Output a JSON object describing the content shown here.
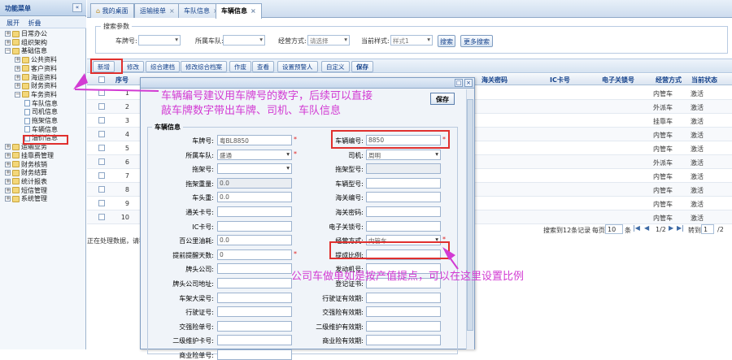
{
  "sidebar": {
    "title": "功能菜单",
    "collapse_glyph": "«",
    "expand_all": "展开",
    "collapse_all": "折叠",
    "items": [
      {
        "label": "日常办公",
        "level": 1,
        "type": "folder",
        "toggle": "+"
      },
      {
        "label": "组织架构",
        "level": 1,
        "type": "folder",
        "toggle": "+"
      },
      {
        "label": "基础信息",
        "level": 1,
        "type": "folder",
        "toggle": "−"
      },
      {
        "label": "公共资料",
        "level": 2,
        "type": "folder",
        "toggle": "+"
      },
      {
        "label": "客户资料",
        "level": 2,
        "type": "folder",
        "toggle": "+"
      },
      {
        "label": "海运资料",
        "level": 2,
        "type": "folder",
        "toggle": "+"
      },
      {
        "label": "财务资料",
        "level": 2,
        "type": "folder",
        "toggle": "+"
      },
      {
        "label": "车务资料",
        "level": 2,
        "type": "folder",
        "toggle": "−"
      },
      {
        "label": "车队信息",
        "level": 3,
        "type": "page",
        "toggle": ""
      },
      {
        "label": "司机信息",
        "level": 3,
        "type": "page",
        "toggle": ""
      },
      {
        "label": "拖架信息",
        "level": 3,
        "type": "page",
        "toggle": ""
      },
      {
        "label": "车辆信息",
        "level": 3,
        "type": "page",
        "toggle": ""
      },
      {
        "label": "油价信息",
        "level": 3,
        "type": "page",
        "toggle": ""
      },
      {
        "label": "运输业务",
        "level": 1,
        "type": "folder",
        "toggle": "+"
      },
      {
        "label": "挂靠费管理",
        "level": 1,
        "type": "folder",
        "toggle": "+"
      },
      {
        "label": "财务核销",
        "level": 1,
        "type": "folder",
        "toggle": "+"
      },
      {
        "label": "财务结算",
        "level": 1,
        "type": "folder",
        "toggle": "+"
      },
      {
        "label": "统计报表",
        "level": 1,
        "type": "folder",
        "toggle": "+"
      },
      {
        "label": "短信管理",
        "level": 1,
        "type": "folder",
        "toggle": "+"
      },
      {
        "label": "系统管理",
        "level": 1,
        "type": "folder",
        "toggle": "+"
      }
    ]
  },
  "tabs": [
    {
      "label": "我的桌面",
      "closable": false
    },
    {
      "label": "运输接单",
      "closable": true
    },
    {
      "label": "车队信息",
      "closable": true
    },
    {
      "label": "车辆信息",
      "closable": true
    }
  ],
  "search": {
    "legend": "搜索参数",
    "vehicle_no_label": "车牌号:",
    "fleet_label": "所属车队:",
    "mode_label": "经营方式:",
    "mode_value": "请选择",
    "style_label": "当前样式:",
    "style_value": "样式1",
    "search_btn": "搜索",
    "more_btn": "更多搜索"
  },
  "toolbar": [
    "新增",
    "修改",
    "综合建档",
    "修改综合档案",
    "作废",
    "查看",
    "设置预警人",
    "自定义",
    "保存"
  ],
  "grid": {
    "headers": {
      "no": "序号",
      "ecard": "海关密码",
      "ic": "IC卡号",
      "key": "电子关锁号",
      "mode": "经营方式",
      "status": "当前状态"
    },
    "rows": [
      {
        "no": "1",
        "mode": "内管车",
        "status": "激活"
      },
      {
        "no": "2",
        "mode": "外派车",
        "status": "激活"
      },
      {
        "no": "3",
        "mode": "挂靠车",
        "status": "激活"
      },
      {
        "no": "4",
        "mode": "内管车",
        "status": "激活"
      },
      {
        "no": "5",
        "mode": "内管车",
        "status": "激活"
      },
      {
        "no": "6",
        "mode": "外派车",
        "status": "激活"
      },
      {
        "no": "7",
        "mode": "内管车",
        "status": "激活"
      },
      {
        "no": "8",
        "mode": "内管车",
        "status": "激活"
      },
      {
        "no": "9",
        "mode": "内管车",
        "status": "激活"
      },
      {
        "no": "10",
        "mode": "内管车",
        "status": "激活"
      }
    ],
    "pager": {
      "found": "搜索到12条记录",
      "per_page_label": "每页",
      "per_page": "10",
      "per_page_unit": "条",
      "page": "1/2",
      "goto_label": "转到",
      "goto_value": "1",
      "goto_unit": "/2"
    },
    "processing": "正在处理数据，请稍"
  },
  "dialog": {
    "save": "保存",
    "section": "车辆信息",
    "left_fields": [
      {
        "label": "车牌号:",
        "value": "粤BL8850",
        "required": true,
        "type": "text"
      },
      {
        "label": "所属车队:",
        "value": "盛通",
        "required": true,
        "type": "select"
      },
      {
        "label": "拖架号:",
        "value": "",
        "required": false,
        "type": "select"
      },
      {
        "label": "拖架重量:",
        "value": "0.0",
        "required": false,
        "type": "readonly"
      },
      {
        "label": "车头重:",
        "value": "0.0",
        "required": false,
        "type": "text"
      },
      {
        "label": "通关卡号:",
        "value": "",
        "required": false,
        "type": "text"
      },
      {
        "label": "IC卡号:",
        "value": "",
        "required": false,
        "type": "text"
      },
      {
        "label": "百公里油耗:",
        "value": "0.0",
        "required": false,
        "type": "text"
      },
      {
        "label": "提前提醒天数:",
        "value": "0",
        "required": true,
        "type": "text"
      },
      {
        "label": "牌头公司:",
        "value": "",
        "required": false,
        "type": "text"
      },
      {
        "label": "牌头公司地址:",
        "value": "",
        "required": false,
        "type": "text"
      },
      {
        "label": "车架大梁号:",
        "value": "",
        "required": false,
        "type": "text"
      },
      {
        "label": "行驶证号:",
        "value": "",
        "required": false,
        "type": "text"
      },
      {
        "label": "交强险单号:",
        "value": "",
        "required": false,
        "type": "text"
      },
      {
        "label": "二级维护卡号:",
        "value": "",
        "required": false,
        "type": "text"
      },
      {
        "label": "商业险单号:",
        "value": "",
        "required": false,
        "type": "text"
      }
    ],
    "right_fields": [
      {
        "label": "车辆编号:",
        "value": "8850",
        "required": true,
        "type": "text"
      },
      {
        "label": "司机:",
        "value": "周明",
        "required": false,
        "type": "select"
      },
      {
        "label": "拖架型号:",
        "value": "",
        "required": false,
        "type": "readonly"
      },
      {
        "label": "车辆型号:",
        "value": "",
        "required": false,
        "type": "text"
      },
      {
        "label": "海关编号:",
        "value": "",
        "required": false,
        "type": "text"
      },
      {
        "label": "海关密码:",
        "value": "",
        "required": false,
        "type": "text"
      },
      {
        "label": "电子关锁号:",
        "value": "",
        "required": false,
        "type": "text"
      },
      {
        "label": "经营方式:",
        "value": "内管车",
        "required": true,
        "type": "select"
      },
      {
        "label": "提成比例:",
        "value": "",
        "required": false,
        "type": "text"
      },
      {
        "label": "发动机号:",
        "value": "",
        "required": false,
        "type": "text"
      },
      {
        "label": "登记证书:",
        "value": "",
        "required": false,
        "type": "text"
      },
      {
        "label": "行驶证有效期:",
        "value": "",
        "required": false,
        "type": "text"
      },
      {
        "label": "交强险有效期:",
        "value": "",
        "required": false,
        "type": "text"
      },
      {
        "label": "二级维护有效期:",
        "value": "",
        "required": false,
        "type": "text"
      },
      {
        "label": "商业险有效期:",
        "value": "",
        "required": false,
        "type": "text"
      }
    ]
  },
  "annotations": {
    "note1_line1": "车辆编号建议用车牌号的数字，后续可以直接",
    "note1_line2": "敲车牌数字带出车牌、司机、车队信息",
    "note2": "公司车做单如是按产值提点，可以在这里设置比例",
    "color": "#d23bd3"
  }
}
